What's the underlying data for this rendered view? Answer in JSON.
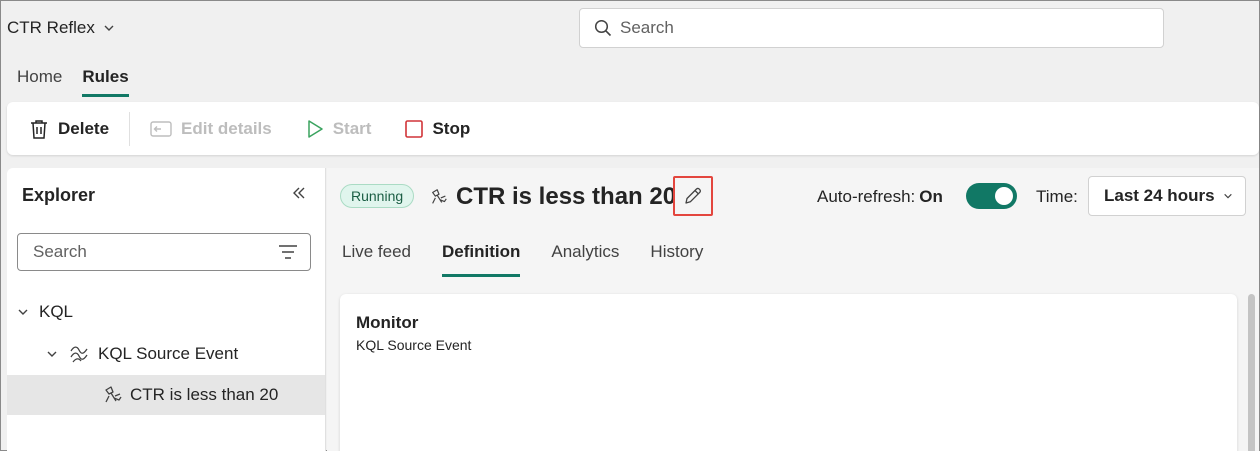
{
  "app": {
    "title": "CTR Reflex"
  },
  "search": {
    "placeholder": "Search"
  },
  "nav_tabs": [
    {
      "label": "Home"
    },
    {
      "label": "Rules"
    }
  ],
  "toolbar": {
    "delete_label": "Delete",
    "edit_details_label": "Edit details",
    "start_label": "Start",
    "stop_label": "Stop"
  },
  "explorer": {
    "title": "Explorer",
    "search_placeholder": "Search",
    "tree": [
      {
        "label": "KQL"
      },
      {
        "label": "KQL Source Event"
      },
      {
        "label": "CTR is less than 20"
      }
    ]
  },
  "rule": {
    "status": "Running",
    "title": "CTR is less than 20",
    "autorefresh_label": "Auto-refresh:",
    "autorefresh_value": "On",
    "time_label": "Time:",
    "time_value": "Last 24 hours"
  },
  "subtabs": [
    {
      "label": "Live feed"
    },
    {
      "label": "Definition"
    },
    {
      "label": "Analytics"
    },
    {
      "label": "History"
    }
  ],
  "monitor": {
    "title": "Monitor",
    "source": "KQL Source Event"
  },
  "colors": {
    "accent": "#117865",
    "highlight_box": "#e3463e",
    "status_bg": "#e0f5ed",
    "start_icon": "#3aa35f",
    "stop_icon": "#d13438"
  }
}
